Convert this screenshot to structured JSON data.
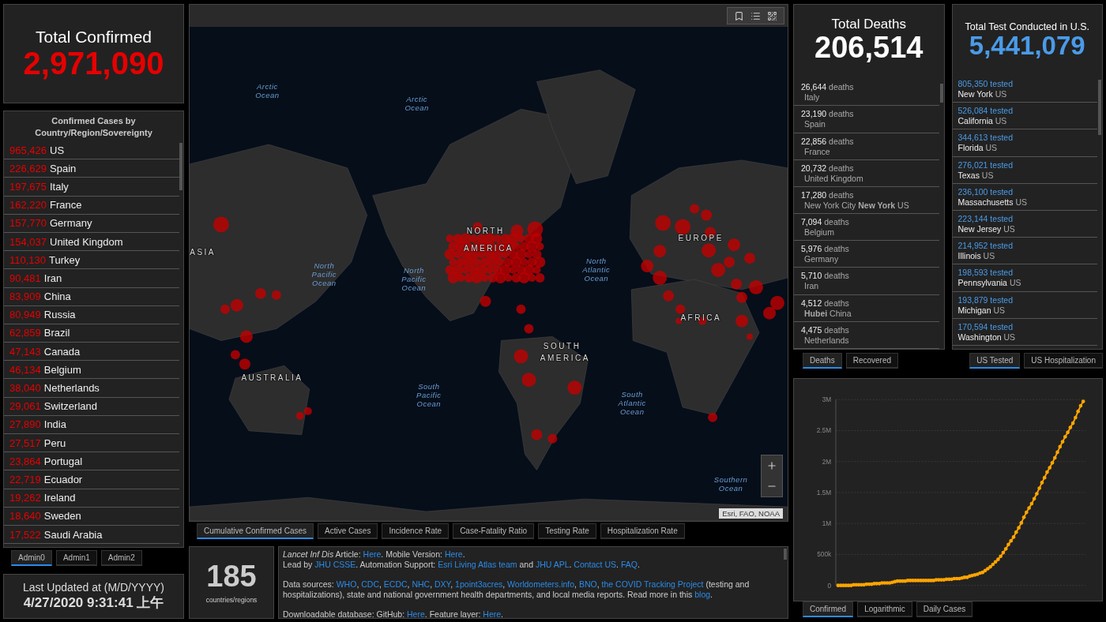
{
  "total_confirmed": {
    "title": "Total Confirmed",
    "value": "2,971,090"
  },
  "confirmed_list": {
    "title": "Confirmed Cases by Country/Region/Sovereignty",
    "rows": [
      {
        "count": "965,426",
        "name": "US"
      },
      {
        "count": "226,629",
        "name": "Spain"
      },
      {
        "count": "197,675",
        "name": "Italy"
      },
      {
        "count": "162,220",
        "name": "France"
      },
      {
        "count": "157,770",
        "name": "Germany"
      },
      {
        "count": "154,037",
        "name": "United Kingdom"
      },
      {
        "count": "110,130",
        "name": "Turkey"
      },
      {
        "count": "90,481",
        "name": "Iran"
      },
      {
        "count": "83,909",
        "name": "China"
      },
      {
        "count": "80,949",
        "name": "Russia"
      },
      {
        "count": "62,859",
        "name": "Brazil"
      },
      {
        "count": "47,143",
        "name": "Canada"
      },
      {
        "count": "46,134",
        "name": "Belgium"
      },
      {
        "count": "38,040",
        "name": "Netherlands"
      },
      {
        "count": "29,061",
        "name": "Switzerland"
      },
      {
        "count": "27,890",
        "name": "India"
      },
      {
        "count": "27,517",
        "name": "Peru"
      },
      {
        "count": "23,864",
        "name": "Portugal"
      },
      {
        "count": "22,719",
        "name": "Ecuador"
      },
      {
        "count": "19,262",
        "name": "Ireland"
      },
      {
        "count": "18,640",
        "name": "Sweden"
      },
      {
        "count": "17,522",
        "name": "Saudi Arabia"
      }
    ]
  },
  "admin_tabs": [
    {
      "label": "Admin0",
      "selected": true
    },
    {
      "label": "Admin1",
      "selected": false
    },
    {
      "label": "Admin2",
      "selected": false
    }
  ],
  "last_updated": {
    "label": "Last Updated at (M/D/YYYY)",
    "value": "4/27/2020 9:31:41 上午"
  },
  "map": {
    "labels": [
      {
        "kind": "ocean",
        "text": "Arctic Ocean"
      },
      {
        "kind": "ocean",
        "text": "Arctic Ocean"
      },
      {
        "kind": "ocean",
        "text": "North Pacific Ocean"
      },
      {
        "kind": "ocean",
        "text": "North Pacific Ocean"
      },
      {
        "kind": "ocean",
        "text": "North Atlantic Ocean"
      },
      {
        "kind": "ocean",
        "text": "South Pacific Ocean"
      },
      {
        "kind": "ocean",
        "text": "South Atlantic Ocean"
      },
      {
        "kind": "ocean",
        "text": "Southern Ocean"
      },
      {
        "kind": "land",
        "text": "ASIA"
      },
      {
        "kind": "land",
        "text": "NORTH"
      },
      {
        "kind": "land",
        "text": "AMERICA"
      },
      {
        "kind": "land",
        "text": "EUROPE"
      },
      {
        "kind": "land",
        "text": "AFRICA"
      },
      {
        "kind": "land",
        "text": "SOUTH"
      },
      {
        "kind": "land",
        "text": "AMERICA"
      },
      {
        "kind": "land",
        "text": "AUSTRALIA"
      }
    ],
    "attribution": "Esri, FAO, NOAA"
  },
  "map_tabs": [
    {
      "label": "Cumulative Confirmed Cases",
      "selected": true
    },
    {
      "label": "Active Cases",
      "selected": false
    },
    {
      "label": "Incidence Rate",
      "selected": false
    },
    {
      "label": "Case-Fatality Ratio",
      "selected": false
    },
    {
      "label": "Testing Rate",
      "selected": false
    },
    {
      "label": "Hospitalization Rate",
      "selected": false
    }
  ],
  "countries": {
    "value": "185",
    "label": "countries/regions"
  },
  "info": {
    "paragraphs": [
      [
        [
          {
            "text": "Lancet Inf Dis",
            "kind": "italic"
          },
          {
            "text": " Article: ",
            "kind": "plain"
          },
          {
            "text": "Here",
            "kind": "link"
          },
          {
            "text": ". Mobile Version: ",
            "kind": "plain"
          },
          {
            "text": "Here",
            "kind": "link"
          },
          {
            "text": ".",
            "kind": "plain"
          }
        ],
        [
          {
            "text": "Lead by ",
            "kind": "plain"
          },
          {
            "text": "JHU CSSE",
            "kind": "link"
          },
          {
            "text": ". Automation Support: ",
            "kind": "plain"
          },
          {
            "text": "Esri Living Atlas team",
            "kind": "link"
          },
          {
            "text": " and ",
            "kind": "plain"
          },
          {
            "text": "JHU APL",
            "kind": "link"
          },
          {
            "text": ". ",
            "kind": "plain"
          },
          {
            "text": "Contact US",
            "kind": "link"
          },
          {
            "text": ". ",
            "kind": "plain"
          },
          {
            "text": "FAQ",
            "kind": "link"
          },
          {
            "text": ".",
            "kind": "plain"
          }
        ]
      ],
      [
        [
          {
            "text": "Data sources: ",
            "kind": "plain"
          },
          {
            "text": "WHO",
            "kind": "link"
          },
          {
            "text": ", ",
            "kind": "plain"
          },
          {
            "text": "CDC",
            "kind": "link"
          },
          {
            "text": ", ",
            "kind": "plain"
          },
          {
            "text": "ECDC",
            "kind": "link"
          },
          {
            "text": ", ",
            "kind": "plain"
          },
          {
            "text": "NHC",
            "kind": "link"
          },
          {
            "text": ", ",
            "kind": "plain"
          },
          {
            "text": "DXY",
            "kind": "link"
          },
          {
            "text": ", ",
            "kind": "plain"
          },
          {
            "text": "1point3acres",
            "kind": "link"
          },
          {
            "text": ", ",
            "kind": "plain"
          },
          {
            "text": "Worldometers.info",
            "kind": "link"
          },
          {
            "text": ", ",
            "kind": "plain"
          },
          {
            "text": "BNO",
            "kind": "link"
          },
          {
            "text": ", ",
            "kind": "plain"
          },
          {
            "text": "the COVID Tracking Project",
            "kind": "link"
          },
          {
            "text": " (testing and hospitalizations), state and national government health departments, and local media reports.  Read more in this ",
            "kind": "plain"
          },
          {
            "text": "blog",
            "kind": "link"
          },
          {
            "text": ".",
            "kind": "plain"
          }
        ]
      ],
      [
        [
          {
            "text": "Downloadable database: GitHub: ",
            "kind": "plain"
          },
          {
            "text": "Here",
            "kind": "link"
          },
          {
            "text": ". Feature layer: ",
            "kind": "plain"
          },
          {
            "text": "Here",
            "kind": "link"
          },
          {
            "text": ".",
            "kind": "plain"
          }
        ]
      ]
    ]
  },
  "total_deaths": {
    "title": "Total Deaths",
    "value": "206,514",
    "rows": [
      {
        "count": "26,644",
        "unit": "deaths",
        "place": "Italy"
      },
      {
        "count": "23,190",
        "unit": "deaths",
        "place": "Spain"
      },
      {
        "count": "22,856",
        "unit": "deaths",
        "place": "France"
      },
      {
        "count": "20,732",
        "unit": "deaths",
        "place": "United Kingdom"
      },
      {
        "count": "17,280",
        "unit": "deaths",
        "place": "New York City **New York** US"
      },
      {
        "count": "7,094",
        "unit": "deaths",
        "place": "Belgium"
      },
      {
        "count": "5,976",
        "unit": "deaths",
        "place": "Germany"
      },
      {
        "count": "5,710",
        "unit": "deaths",
        "place": "Iran"
      },
      {
        "count": "4,512",
        "unit": "deaths",
        "place": "**Hubei** China"
      },
      {
        "count": "4,475",
        "unit": "deaths",
        "place": "Netherlands"
      }
    ]
  },
  "deaths_tabs": [
    {
      "label": "Deaths",
      "selected": true
    },
    {
      "label": "Recovered",
      "selected": false
    }
  ],
  "total_tests": {
    "title": "Total Test Conducted in U.S.",
    "value": "5,441,079",
    "rows": [
      {
        "count": "805,350 tested",
        "state": "New York",
        "country": "US"
      },
      {
        "count": "526,084 tested",
        "state": "California",
        "country": "US"
      },
      {
        "count": "344,613 tested",
        "state": "Florida",
        "country": "US"
      },
      {
        "count": "276,021 tested",
        "state": "Texas",
        "country": "US"
      },
      {
        "count": "236,100 tested",
        "state": "Massachusetts",
        "country": "US"
      },
      {
        "count": "223,144 tested",
        "state": "New Jersey",
        "country": "US"
      },
      {
        "count": "214,952 tested",
        "state": "Illinois",
        "country": "US"
      },
      {
        "count": "198,593 tested",
        "state": "Pennsylvania",
        "country": "US"
      },
      {
        "count": "193,879 tested",
        "state": "Michigan",
        "country": "US"
      },
      {
        "count": "170,594 tested",
        "state": "Washington",
        "country": "US"
      }
    ]
  },
  "tests_tabs": [
    {
      "label": "US Tested",
      "selected": true
    },
    {
      "label": "US Hospitalization",
      "selected": false
    }
  ],
  "chart": {
    "chart_data": {
      "type": "line",
      "grid": true,
      "ylim": [
        0,
        3000000
      ],
      "yticks": [
        {
          "value": 0,
          "label": "0"
        },
        {
          "value": 500000,
          "label": "500k"
        },
        {
          "value": 1000000,
          "label": "1M"
        },
        {
          "value": 1500000,
          "label": "1.5M"
        },
        {
          "value": 2000000,
          "label": "2M"
        },
        {
          "value": 2500000,
          "label": "2.5M"
        },
        {
          "value": 3000000,
          "label": "3M"
        }
      ],
      "categories": [
        null,
        null,
        null,
        null,
        null,
        null,
        null,
        null,
        null,
        null,
        null,
        null,
        null,
        null,
        null,
        null,
        null,
        null,
        null,
        null,
        null,
        null,
        null,
        null,
        null,
        null,
        null,
        null,
        null,
        null,
        null,
        null,
        null,
        null,
        null,
        null,
        null,
        null,
        null,
        null,
        null,
        null,
        null,
        null,
        null,
        null,
        null,
        null,
        null,
        null,
        null,
        null,
        null,
        null,
        null,
        null,
        null,
        null,
        null,
        null,
        null,
        null,
        null,
        null,
        null,
        null,
        null,
        null,
        null,
        null,
        null,
        null,
        null,
        null,
        null,
        null,
        null,
        null,
        null,
        null,
        null,
        null,
        null,
        null,
        null,
        null,
        null,
        null,
        null,
        null,
        null,
        null,
        null,
        null,
        null,
        null
      ],
      "series": [
        {
          "color": "#ffa500",
          "values": [
            0,
            0,
            0,
            0,
            0,
            0,
            10000,
            10000,
            10000,
            10000,
            10000,
            20000,
            20000,
            20000,
            30000,
            30000,
            30000,
            40000,
            40000,
            40000,
            40000,
            50000,
            60000,
            70000,
            70000,
            70000,
            70000,
            80000,
            80000,
            80000,
            80000,
            80000,
            80000,
            80000,
            80000,
            80000,
            80000,
            80000,
            90000,
            90000,
            90000,
            90000,
            100000,
            100000,
            100000,
            110000,
            110000,
            110000,
            120000,
            130000,
            130000,
            150000,
            160000,
            170000,
            180000,
            200000,
            210000,
            240000,
            270000,
            300000,
            340000,
            380000,
            420000,
            470000,
            530000,
            590000,
            660000,
            720000,
            780000,
            860000,
            930000,
            1010000,
            1100000,
            1180000,
            1250000,
            1320000,
            1400000,
            1480000,
            1570000,
            1660000,
            1740000,
            1830000,
            1900000,
            1980000,
            2060000,
            2150000,
            2240000,
            2320000,
            2400000,
            2470000,
            2550000,
            2620000,
            2710000,
            2810000,
            2900000,
            2970000
          ]
        }
      ]
    }
  },
  "chart_tabs": [
    {
      "label": "Confirmed",
      "selected": true
    },
    {
      "label": "Logarithmic",
      "selected": false
    },
    {
      "label": "Daily Cases",
      "selected": false
    }
  ]
}
